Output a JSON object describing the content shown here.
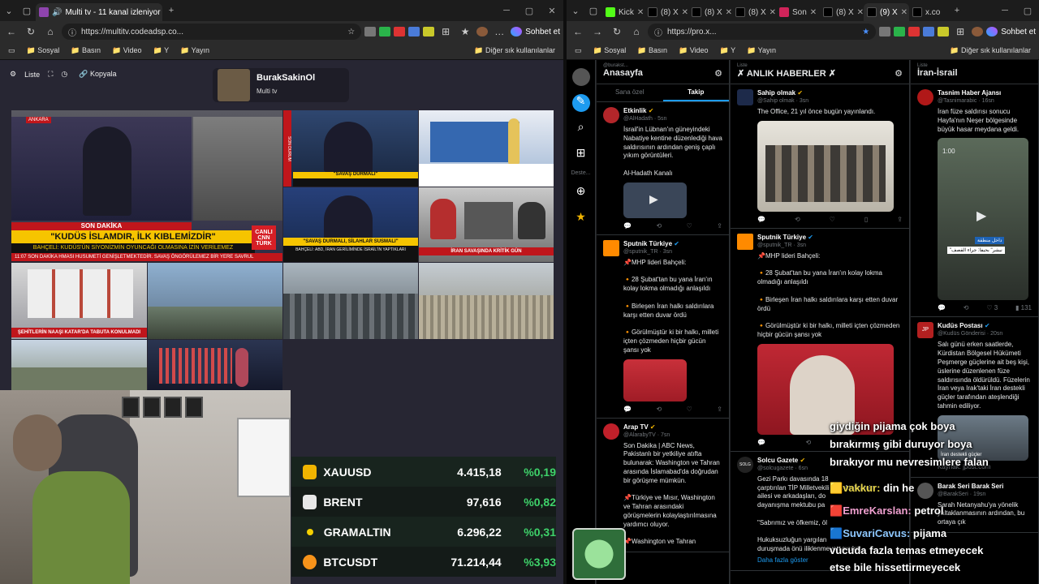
{
  "left_window": {
    "tab_title": "Multi tv - 11 kanal izleniyor",
    "url": "https://multitv.codeadsp.co...",
    "chat_label": "Sohbet et",
    "bookmarks": [
      "Sosyal",
      "Basın",
      "Video",
      "Y",
      "Yayın"
    ],
    "bookmarks_right": "Diğer sık kullanılanlar"
  },
  "multitv": {
    "toolbar": {
      "list": "Liste",
      "copy": "Kopyala"
    },
    "channel": {
      "name": "BurakSakinOl",
      "subtitle": "Multi tv"
    },
    "videos": {
      "v1_banner": "SON DAKİKA",
      "v1_headline": "\"KUDÜS İSLAMDIR, İLK KIBLEMİZDİR\"",
      "v1_subline": "BAHÇELİ: KUDÜS'ÜN SİYONİZMİN OYUNCAĞI OLMASINA İZİN VERİLEMEZ",
      "v1_logo": "CNN TÜRK",
      "v1_ticker": "11:07  SON DAKİKA  HMASI HUSUMETİ GENİŞLETMEKTEDİR. SAVAŞ ÖNGÖRÜLEMEZ BİR YERE SAVRUL",
      "v1_live": "CANLI",
      "v1_tag": "ANKARA",
      "v2_caption": "\"SAVAŞ DURMALI\"",
      "v2_logo": "SON DURUM",
      "v4_headline": "\"SAVAŞ DURMALI, SİLAHLAR SUSMALI\"",
      "v4_sub": "BAHÇELİ: ABD, İRAN GERİLİMİNDE İSRAİL'İN YAPTIKLARI",
      "v5_caption": "İRAN SAVAŞINDA KRİTİK GÜN",
      "v6_caption": "ŞEHİTLERİN NAAŞI KATAR'DA TABUTA KONULMADI"
    }
  },
  "tickers": [
    {
      "name": "XAUUSD",
      "price": "4.415,18",
      "change": "%0,19",
      "color": "#f0b400"
    },
    {
      "name": "BRENT",
      "price": "97,616",
      "change": "%0,82",
      "color": "#e8e8e8"
    },
    {
      "name": "GRAMALTIN",
      "price": "6.296,22",
      "change": "%0,31",
      "color": "#f5d000"
    },
    {
      "name": "BTCUSDT",
      "price": "71.214,44",
      "change": "%3,93",
      "color": "#f7931a"
    }
  ],
  "right_window": {
    "tabs": [
      "Kick",
      "(8) X",
      "(8) X",
      "(8) X",
      "Son",
      "(8) X",
      "(9) X",
      "x.co"
    ],
    "url": "https://pro.x...",
    "chat_label": "Sohbet et",
    "bookmarks": [
      "Sosyal",
      "Basın",
      "Video",
      "Y",
      "Yayın"
    ],
    "bookmarks_right": "Diğer sık kullanılanlar"
  },
  "x_sidebar": {
    "label": "Deste..."
  },
  "columns": {
    "c1": {
      "owner": "@burakst...",
      "title": "Anasayfa",
      "tabs": [
        "Sana özel",
        "Takip"
      ],
      "tweets": [
        {
          "name": "Etkinlik",
          "handle": "@AlHadath · 5sn",
          "text": "İsrail'in Lübnan'ın güneyindeki Nabatiye kentine düzenlediği hava saldırısının ardından geniş çaplı yıkım görüntüleri.\n\nAl-Hadath Kanalı",
          "color": "#b3262a"
        },
        {
          "name": "Sputnik Türkiye",
          "handle": "@sputnik_TR · 3sn",
          "text": "📌MHP lideri Bahçeli:\n\n🔸28 Şubat'tan bu yana İran'ın kolay lokma olmadığı anlaşıldı\n\n🔸Birleşen İran halkı saldırılara karşı etten duvar ördü\n\n🔸Görülmüştür ki bir halkı, milleti içten çözmeden hiçbir gücün şansı yok",
          "color": "#ff8a00"
        },
        {
          "name": "Arap TV",
          "handle": "@AlarabyTV · 7sn",
          "text": "Son Dakika | ABC News, Pakistanlı bir yetkiliye atıfta bulunarak: Washington ve Tahran arasında İslamabad'da doğrudan bir görüşme mümkün.\n\n📌Türkiye ve Mısır, Washington ve Tahran arasındaki görüşmelerin kolaylaştırılmasına yardımcı oluyor.\n\n📌Washington ve Tahran",
          "color": "#c0202a"
        }
      ],
      "actions": [
        "",
        "",
        "",
        ""
      ]
    },
    "c2": {
      "owner": "Liste",
      "title": "✗ ANLIK HABERLER ✗",
      "tweets": [
        {
          "name": "Sahip olmak",
          "handle": "@Sahip olmak · 3sn",
          "text": "The Office, 21 yıl önce bugün yayınlandı.",
          "color": "#1d2a4a"
        },
        {
          "name": "Sputnik Türkiye",
          "handle": "@sputnik_TR · 3sn",
          "text": "📌MHP lideri Bahçeli:\n\n🔸28 Şubat'tan bu yana İran'ın kolay lokma olmadığı anlaşıldı\n\n🔸Birleşen İran halkı saldırılara karşı etten duvar ördü\n\n🔸Görülmüştür ki bir halkı, milleti içten çözmeden hiçbir gücün şansı yok",
          "color": "#ff8a00"
        },
        {
          "name": "Solcu Gazete",
          "handle": "@solcugazete · 6sn",
          "text": "Gezi Parkı davasında 18\nçarptırılan TİP Milletvekili Can Atalay için\nailesi ve arkadaşları, do\ndayanışma mektubu pa\n\n\"Sabrımız ve öfkemiz, öl\n\nHukuksuzluğun yargılan\nduruşmada önü iliklenmeyen avukat",
          "color": "#222"
        }
      ],
      "more": "Daha fazla göster"
    },
    "c3": {
      "owner": "Liste",
      "title": "İran-İsrail",
      "tweets": [
        {
          "name": "Tasnim Haber Ajansı",
          "handle": "@Tasnimarabic · 16sn",
          "text": "İran füze saldırısı sonucu Hayfa'nın Neşer bölgesinde büyük hasar meydana geldi.",
          "color": "#b01818"
        },
        {
          "name": "Kudüs Postası",
          "handle": "@Kudüs Gönderisi · 20sn",
          "text": "Salı günü erken saatlerde, Kürdistan Bölgesel Hükümeti Peşmerge güçlerine ait beş kişi, üslerine düzenlenen füze saldırısında öldürüldü. Füzelerin İran veya Irak'taki İran destekli güçler tarafından ateşlendiği tahmin ediliyor.",
          "color": "#b32020"
        },
        {
          "name": "Barak Seri Barak Seri",
          "handle": "@BarakSeri · 19sn",
          "text": "Sarah Netanyahu'ya yönelik yaltaklanmasının ardından, bu ortaya çık",
          "color": "#555"
        }
      ],
      "video_time": "1:00",
      "video_caption": "\"نيشر\" بحيفا: جراء القصف",
      "video_badge": "داخل منطقة",
      "video_sub": "İran destekli güçler",
      "source": "Kaynak: jpost.com",
      "stats": {
        "likes": "3",
        "views": "131"
      }
    }
  },
  "chat_overlay": [
    {
      "user": "",
      "text": "giydiğin pijama çok boya"
    },
    {
      "user": "",
      "text": "bırakırmış gibi duruyor boya"
    },
    {
      "user": "",
      "text": "bırakıyor mu nevresimlere falan"
    },
    {
      "user": "vakkur:",
      "text": "din he"
    },
    {
      "user": "EmreKarslan:",
      "text": "petrol"
    },
    {
      "user": "SuvariCavus:",
      "text": "pijama"
    },
    {
      "user": "",
      "text": "vücuda fazla temas etmeyecek"
    },
    {
      "user": "",
      "text": "etse bile hissettirmeyecek"
    }
  ]
}
